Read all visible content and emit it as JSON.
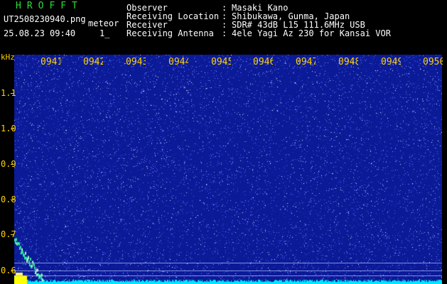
{
  "header": {
    "logo": "HROFFT",
    "filename": "UT2508230940.png",
    "mode": "meteor",
    "datetime": "25.08.23 09:40",
    "page": "1_",
    "meta": [
      {
        "label": "Observer",
        "value": "Masaki Kano"
      },
      {
        "label": "Receiving Location",
        "value": "Shibukawa, Gunma, Japan"
      },
      {
        "label": "Receiver",
        "value": "SDR# 43dB L15 111.6MHz USB"
      },
      {
        "label": "Receiving Antenna",
        "value": "4ele Yagi Az 230 for Kansai VOR"
      }
    ]
  },
  "spectrogram": {
    "unit_label": "kHz",
    "time_labels": [
      "0941",
      "0942",
      "0943",
      "0944",
      "0945",
      "0946",
      "0947",
      "0948",
      "0949",
      "0950"
    ],
    "freq_labels": [
      "1.1",
      "1.0",
      "0.9",
      "0.8",
      "0.7",
      "0.6"
    ],
    "colors": {
      "background": "#0b1a96",
      "noise_light": "#5f6cff",
      "axis_text": "#ffd200",
      "trace": "#00e6ff",
      "signal": "#ffff00"
    }
  }
}
